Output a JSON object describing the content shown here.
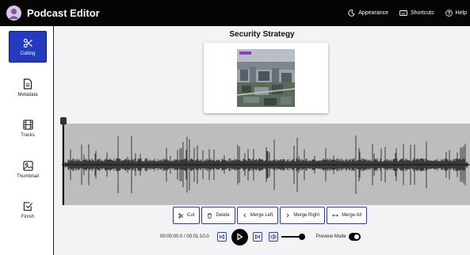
{
  "app": {
    "title": "Podcast Editor"
  },
  "header": {
    "actions": [
      {
        "label": "Appearance",
        "icon": "appearance-icon"
      },
      {
        "label": "Shortcuts",
        "icon": "keyboard-icon"
      },
      {
        "label": "Help",
        "icon": "help-icon"
      }
    ]
  },
  "sidebar": {
    "items": [
      {
        "label": "Cutting",
        "icon": "scissors-icon",
        "active": true
      },
      {
        "label": "Metadata",
        "icon": "document-icon",
        "active": false
      },
      {
        "label": "Tracks",
        "icon": "film-icon",
        "active": false
      },
      {
        "label": "Thumbnail",
        "icon": "image-icon",
        "active": false
      },
      {
        "label": "Finish",
        "icon": "checkbox-icon",
        "active": false
      }
    ]
  },
  "editor": {
    "episode_title": "Security Strategy",
    "tools": [
      {
        "label": "Cut",
        "icon": "scissors-icon"
      },
      {
        "label": "Delete",
        "icon": "trash-icon"
      },
      {
        "label": "Merge Left",
        "icon": "chevron-left-icon"
      },
      {
        "label": "Merge Right",
        "icon": "chevron-right-icon"
      },
      {
        "label": "Merge All",
        "icon": "arrows-horizontal-icon"
      }
    ],
    "playback": {
      "time_readout": "00:00:00.0 / 00:01:10.0",
      "volume": 0.88,
      "preview_mode_label": "Preview Mode",
      "preview_mode_on": true
    }
  },
  "colors": {
    "accent": "#233bc0",
    "topbar": "#050505",
    "track": "#bdbdbd",
    "waveform": "#1a1a1a"
  }
}
